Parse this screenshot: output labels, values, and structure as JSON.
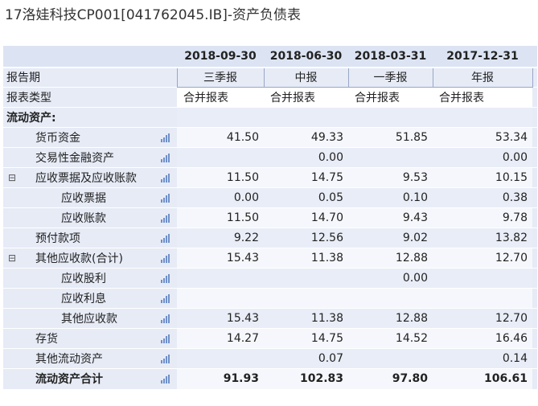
{
  "title": "17洛娃科技CP001[041762045.IB]-资产负债表",
  "columns": [
    {
      "date": "2018-09-30",
      "period": "三季报",
      "type": "合并报表"
    },
    {
      "date": "2018-06-30",
      "period": "中报",
      "type": "合并报表"
    },
    {
      "date": "2018-03-31",
      "period": "一季报",
      "type": "合并报表"
    },
    {
      "date": "2017-12-31",
      "period": "年报",
      "type": "合并报表"
    }
  ],
  "labels": {
    "period": "报告期",
    "type": "报表类型"
  },
  "toggle_glyph": "⊟",
  "rows": [
    {
      "label": "流动资产:",
      "values": [
        "",
        "",
        "",
        ""
      ]
    },
    {
      "label": "货币资金",
      "values": [
        "41.50",
        "49.33",
        "51.85",
        "53.34"
      ]
    },
    {
      "label": "交易性金融资产",
      "values": [
        "",
        "0.00",
        "",
        "0.00"
      ]
    },
    {
      "label": "应收票据及应收账款",
      "values": [
        "11.50",
        "14.75",
        "9.53",
        "10.15"
      ]
    },
    {
      "label": "应收票据",
      "values": [
        "0.00",
        "0.05",
        "0.10",
        "0.38"
      ]
    },
    {
      "label": "应收账款",
      "values": [
        "11.50",
        "14.70",
        "9.43",
        "9.78"
      ]
    },
    {
      "label": "预付款项",
      "values": [
        "9.22",
        "12.56",
        "9.02",
        "13.82"
      ]
    },
    {
      "label": "其他应收款(合计)",
      "values": [
        "15.43",
        "11.38",
        "12.88",
        "12.70"
      ]
    },
    {
      "label": "应收股利",
      "values": [
        "",
        "",
        "0.00",
        ""
      ]
    },
    {
      "label": "应收利息",
      "values": [
        "",
        "",
        "",
        ""
      ]
    },
    {
      "label": "其他应收款",
      "values": [
        "15.43",
        "11.38",
        "12.88",
        "12.70"
      ]
    },
    {
      "label": "存货",
      "values": [
        "14.27",
        "14.75",
        "14.52",
        "16.46"
      ]
    },
    {
      "label": "其他流动资产",
      "values": [
        "",
        "0.07",
        "",
        "0.14"
      ]
    },
    {
      "label": "流动资产合计",
      "values": [
        "91.93",
        "102.83",
        "97.80",
        "106.61"
      ]
    }
  ],
  "colors": {
    "header_bg": "#dce4f3",
    "label_bg": "#e6ebf6",
    "icon": "#6f8fc9"
  }
}
